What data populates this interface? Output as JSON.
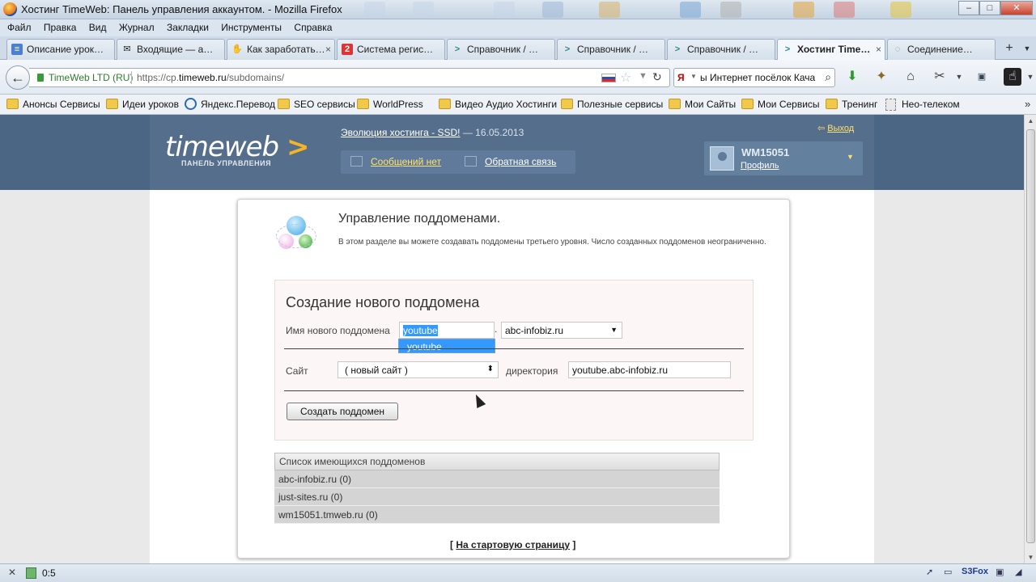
{
  "window": {
    "title": "Хостинг TimeWeb: Панель управления аккаунтом. - Mozilla Firefox",
    "minimize": "–",
    "maximize": "□",
    "close": "✕"
  },
  "menu": [
    "Файл",
    "Правка",
    "Вид",
    "Журнал",
    "Закладки",
    "Инструменты",
    "Справка"
  ],
  "tabs": [
    {
      "label": "Описание урок…",
      "icon": "doc-icon"
    },
    {
      "label": "Входящие — а…",
      "icon": "mail-icon"
    },
    {
      "label": "Как заработать…",
      "icon": "hand-icon"
    },
    {
      "label": "Система регис…",
      "icon": "z-icon"
    },
    {
      "label": "Справочник / …",
      "icon": "chevron-icon"
    },
    {
      "label": "Справочник / …",
      "icon": "chevron-icon"
    },
    {
      "label": "Справочник / …",
      "icon": "chevron-icon"
    },
    {
      "label": "Хостинг Time…",
      "icon": "chevron-icon",
      "active": true
    },
    {
      "label": "Соединение…",
      "icon": "loading-icon"
    }
  ],
  "tab_close": "×",
  "tab_new": "+",
  "tab_list": "▼",
  "nav": {
    "site_identity": "TimeWeb  LTD (RU)",
    "url_prefix": "https://cp.",
    "url_domain": "timeweb.ru",
    "url_path": "/subdomains/",
    "search_engine": "Я",
    "search_query": "ы Интернет посёлок Кача"
  },
  "bookmarks": [
    {
      "label": "Анонсы Сервисы",
      "icon": "folder"
    },
    {
      "label": "Идеи уроков",
      "icon": "folder"
    },
    {
      "label": "Яндекс.Перевод",
      "icon": "globe"
    },
    {
      "label": "SEO сервисы",
      "icon": "folder"
    },
    {
      "label": "WorldPress",
      "icon": "folder"
    },
    {
      "label": "Видео Аудио Хостинги",
      "icon": "folder"
    },
    {
      "label": "Полезные сервисы",
      "icon": "folder"
    },
    {
      "label": "Мои Сайты",
      "icon": "folder"
    },
    {
      "label": "Мои Сервисы",
      "icon": "folder"
    },
    {
      "label": "Тренинг",
      "icon": "folder"
    },
    {
      "label": "Нео-телеком",
      "icon": "page"
    }
  ],
  "bookmarks_more": "»",
  "site": {
    "logo": "timeweb",
    "logo_arrow": ">",
    "logo_sub": "ПАНЕЛЬ УПРАВЛЕНИЯ",
    "news_link": "Эволюция хостинга - SSD!",
    "news_date": " — 16.05.2013",
    "messages_link": "Сообщений нет",
    "feedback_link": "Обратная связь",
    "logout": "Выход",
    "username": "WM15051",
    "profile_link": "Профиль"
  },
  "panel": {
    "title": "Управление поддоменами.",
    "description": "В этом разделе вы можете создавать поддомены третьего уровня. Число созданных поддоменов неограниченно."
  },
  "form": {
    "title": "Создание нового поддомена",
    "subdomain_label": "Имя нового поддомена",
    "subdomain_value": "youtube",
    "dot": ".",
    "domain_selected": "abc-infobiz.ru",
    "autocomplete_item": "youtube",
    "site_label": "Сайт",
    "site_selected": "( новый сайт )",
    "dir_label": "директория",
    "dir_value": "youtube.abc-infobiz.ru",
    "submit": "Создать поддомен"
  },
  "list": {
    "header": "Список имеющихся поддоменов",
    "rows": [
      "abc-infobiz.ru (0)",
      "just-sites.ru (0)",
      "wm15051.tmweb.ru (0)"
    ]
  },
  "home": {
    "bracket_open": "[ ",
    "link": "На стартовую страницу",
    "bracket_close": " ]"
  },
  "status": {
    "close": "✕",
    "text": "0:5",
    "s3fox": "S3Fox"
  },
  "colors": {
    "header": "#556e8c",
    "accent_yellow": "#ffe16e",
    "selection": "#3399ff"
  }
}
